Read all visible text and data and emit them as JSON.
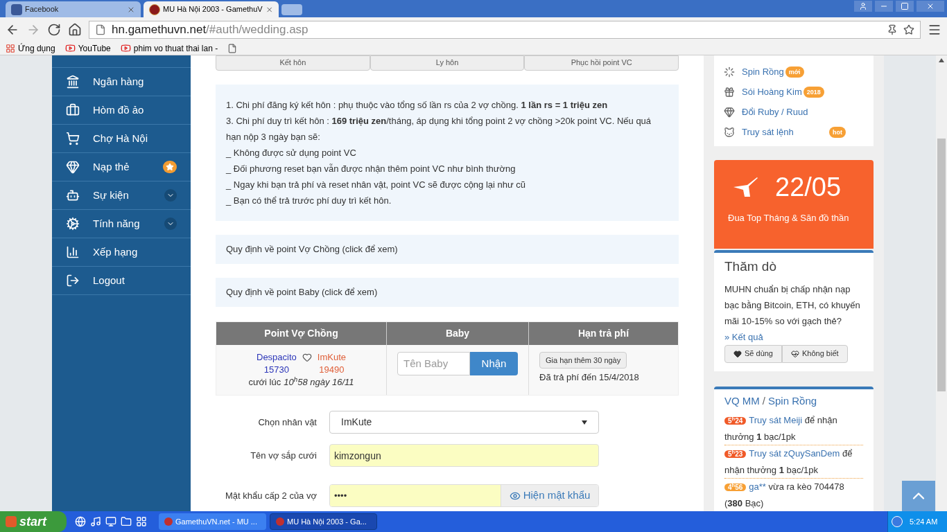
{
  "browser": {
    "tabs": [
      {
        "title": "Facebook",
        "kind": "facebook",
        "selected": false
      },
      {
        "title": "MU Hà Nội 2003 - GamethuV",
        "kind": "game",
        "selected": true
      }
    ],
    "url": {
      "domain": "hn.gamethuvn.net",
      "path": "/#auth/wedding.asp"
    },
    "bookmarks": [
      {
        "label": "Ứng dụng",
        "kind": "apps"
      },
      {
        "label": "YouTube",
        "kind": "youtube"
      },
      {
        "label": "phim vo thuat thai lan -",
        "kind": "youtube"
      },
      {
        "kind": "file"
      }
    ]
  },
  "sidebar": {
    "items": [
      {
        "label": "Ngân hàng",
        "kind": "bank"
      },
      {
        "label": "Hòm đồ ảo",
        "kind": "case"
      },
      {
        "label": "Chợ Hà Nội",
        "kind": "cart"
      },
      {
        "label": "Nạp thẻ",
        "kind": "gem",
        "starred": true
      },
      {
        "label": "Sự kiện",
        "kind": "android",
        "expanded": false
      },
      {
        "label": "Tính năng",
        "kind": "gears",
        "expanded": false
      },
      {
        "label": "Xếp hạng",
        "kind": "chart"
      },
      {
        "label": "Logout",
        "kind": "logout"
      }
    ]
  },
  "tabs": [
    "Kết hôn",
    "Ly hôn",
    "Phục hồi point VC"
  ],
  "rules": [
    "1. Chi phí đăng ký kết hôn : phụ thuộc vào tổng số lần rs của 2 vợ chồng. **1 lần rs = 1 triệu zen**",
    "3. Chi phí duy trì kết hôn : **169 triệu zen**/tháng, áp dụng khi tổng point 2 vợ chồng >20k point VC. Nếu quá hạn nộp 3 ngày bạn sẽ:",
    "_ Không được sử dụng point VC",
    "_ Đối phương reset bạn vẫn được nhận thêm point VC như bình thường",
    "_ Ngay khi bạn trả phí và reset nhân vật, point VC sẽ được cộng lại như cũ",
    "_ Bạn có thể trả trước phí duy trì kết hôn."
  ],
  "panels": [
    "Quy định về point Vợ Chồng (click để xem)",
    "Quy định về point Baby (click để xem)"
  ],
  "couple_table": {
    "columns": [
      "Point Vợ Chồng",
      "Baby",
      "Hạn trả phí"
    ],
    "husband": {
      "name": "Despacito",
      "points": "15730"
    },
    "wife": {
      "name": "ImKute",
      "points": "19490"
    },
    "wedding_label": "cưới lúc",
    "wedding_time": "10$^{h}$58 ngày 16/11",
    "baby_placeholder": "Tên Baby",
    "baby_button": "Nhận",
    "extend_button": "Gia hạn thêm 30 ngày",
    "paid_until": "Đã trả phí đến 15/4/2018"
  },
  "form": {
    "character": {
      "label": "Chọn nhân vật",
      "value": "ImKute"
    },
    "spouse": {
      "label": "Tên vợ sắp cưới",
      "value": "kimzongun"
    },
    "password": {
      "label": "Mật khẩu cấp 2 của vợ",
      "value": "••••",
      "button": "Hiện mật khẩu"
    }
  },
  "links": [
    {
      "label": "Spin Rồng",
      "kind": "spinner",
      "badge": "mới"
    },
    {
      "label": "Sói Hoàng Kim",
      "kind": "gift",
      "badge": "2018"
    },
    {
      "label": "Đổi Ruby / Ruud",
      "kind": "gem"
    },
    {
      "label": "Truy sát lệnh",
      "kind": "cat",
      "badge": "hot"
    }
  ],
  "event": {
    "date": "22/05",
    "text": "Đua Top Tháng & Săn đồ thần"
  },
  "poll": {
    "title": "Thăm dò",
    "question": "MUHN chuẩn bị chấp nhận nạp bạc bằng Bitcoin, ETH, có khuyến mãi 10-15% so với gạch thẻ?",
    "result_link": "» Kết quả",
    "options": [
      {
        "label": "Sẽ dùng",
        "kind": "heart"
      },
      {
        "label": "Không biết",
        "kind": "heartbeat"
      }
    ]
  },
  "feed": {
    "title_links": [
      "VQ MM",
      "Spin Rồng"
    ],
    "separator": "/",
    "items": [
      {
        "time": "5$^{h}$24",
        "color": "#f05a28",
        "link": "Truy sát Meiji",
        "text": "để nhận thưởng **1** bạc/1pk"
      },
      {
        "time": "5$^{h}$23",
        "color": "#f05a28",
        "link": "Truy sát zQuySanDem",
        "text": "để nhận thưởng **1** bạc/1pk"
      },
      {
        "time": "4$^{h}$56",
        "color": "#f7a035",
        "link": "ga**",
        "text": "vừa ra kèo 704478 (**380** Bạc)"
      }
    ]
  },
  "taskbar": {
    "start": "start",
    "tasks": [
      {
        "title": "GamethuVN.net - MU ...",
        "selected": false
      },
      {
        "title": "MU Hà Nội 2003 - Ga...",
        "selected": true
      }
    ],
    "time": "5:24 AM"
  }
}
